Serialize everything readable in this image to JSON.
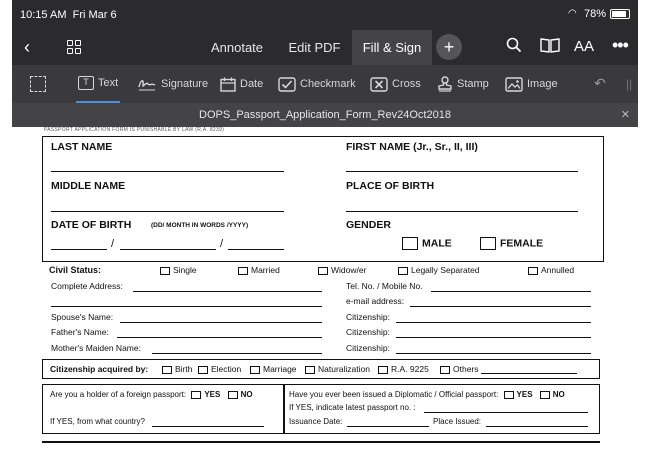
{
  "status": {
    "time": "10:15 AM",
    "date": "Fri Mar 6",
    "battery": "78%"
  },
  "nav": {
    "tabs": [
      {
        "label": "Annotate"
      },
      {
        "label": "Edit PDF"
      },
      {
        "label": "Fill & Sign"
      }
    ],
    "plus": "+",
    "text_size": "AA"
  },
  "tools": {
    "items": [
      {
        "label": "Text",
        "icon": "text-box-icon"
      },
      {
        "label": "Signature",
        "icon": "signature-icon"
      },
      {
        "label": "Date",
        "icon": "calendar-icon"
      },
      {
        "label": "Checkmark",
        "icon": "checkmark-icon"
      },
      {
        "label": "Cross",
        "icon": "cross-icon"
      },
      {
        "label": "Stamp",
        "icon": "stamp-icon"
      },
      {
        "label": "Image",
        "icon": "image-icon"
      }
    ]
  },
  "document": {
    "title": "DOPS_Passport_Application_Form_Rev24Oct2018"
  },
  "form": {
    "header_note": "PASSPORT APPLICATION FORM IS PUNISHABLE BY LAW (R.A. 8239)",
    "last_name": "LAST NAME",
    "first_name": "FIRST NAME (Jr., Sr., II, III)",
    "middle_name": "MIDDLE NAME",
    "place_of_birth": "PLACE OF BIRTH",
    "date_of_birth": "DATE OF BIRTH",
    "dob_format": "(DD/ MONTH IN WORDS /YYYY)",
    "slash": "/",
    "gender": "GENDER",
    "male": "MALE",
    "female": "FEMALE",
    "civil_status": "Civil Status:",
    "civil_options": [
      "Single",
      "Married",
      "Widow/er",
      "Legally Separated",
      "Annulled"
    ],
    "complete_address": "Complete Address:",
    "tel_no": "Tel. No. / Mobile No.",
    "email": "e-mail address:",
    "spouse": "Spouse's Name:",
    "father": "Father's Name:",
    "mother": "Mother's Maiden Name:",
    "citizenship": "Citizenship:",
    "cit_acquired": "Citizenship acquired by:",
    "cit_options": [
      "Birth",
      "Election",
      "Marriage",
      "Naturalization",
      "R.A. 9225",
      "Others"
    ],
    "foreign_q": "Are you a holder of a foreign passport:",
    "yes": "YES",
    "no": "NO",
    "if_yes_country": "If YES, from what country?",
    "diplomatic_q": "Have you ever been issued a Diplomatic / Official passport:",
    "if_yes_latest": "If YES, indicate latest passport no. :",
    "issuance_date": "Issuance Date:",
    "place_issued": "Place Issued:"
  }
}
